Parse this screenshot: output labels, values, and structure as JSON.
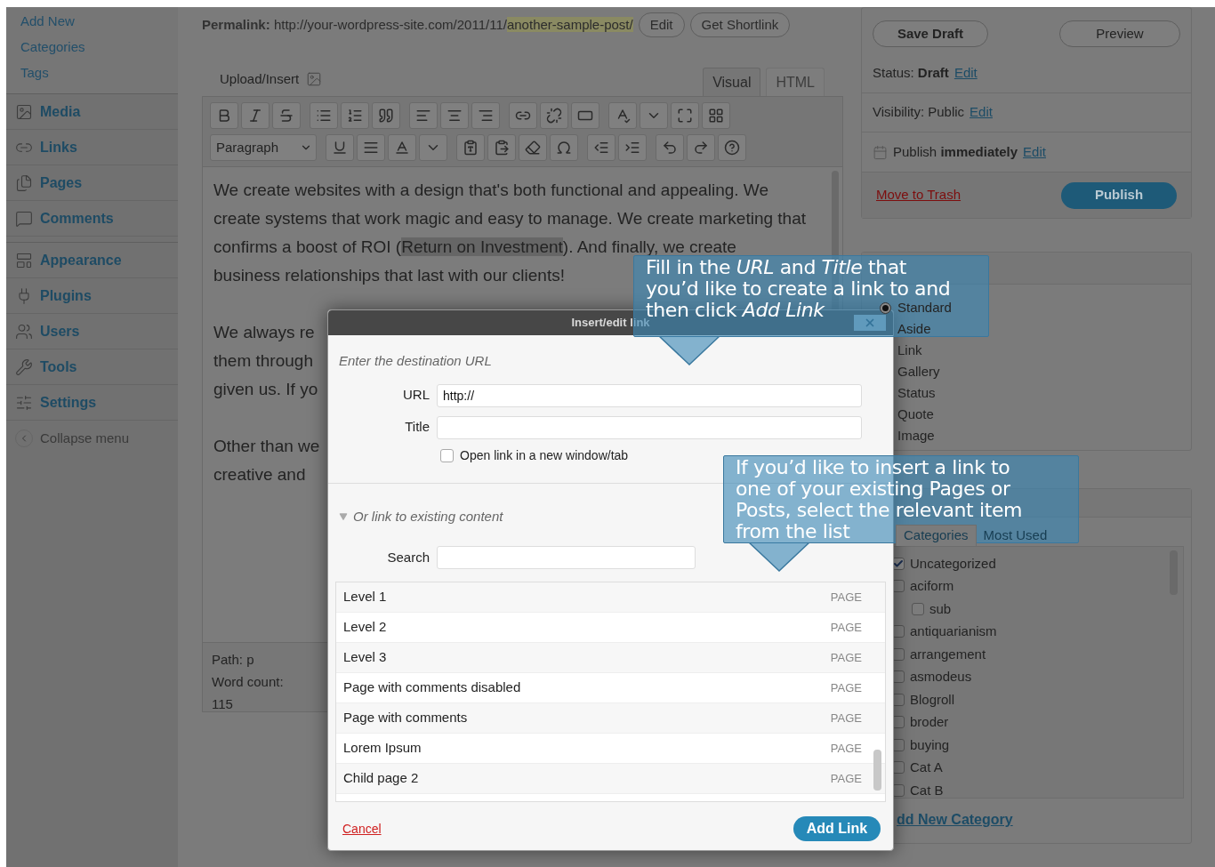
{
  "sidebar": {
    "submenu": [
      "Add New",
      "Categories",
      "Tags"
    ],
    "menu_groups": [
      {
        "items": [
          "Media",
          "Links",
          "Pages",
          "Comments"
        ]
      },
      {
        "items": [
          "Appearance",
          "Plugins",
          "Users",
          "Tools",
          "Settings"
        ]
      }
    ],
    "collapse": "Collapse menu"
  },
  "permalink": {
    "label": "Permalink:",
    "base": "http://your-wordpress-site.com/2011/11/",
    "slug": "another-sample-post/",
    "buttons": [
      "Edit",
      "Get Shortlink"
    ]
  },
  "upload_insert": "Upload/Insert",
  "editor_tabs": [
    {
      "label": "Visual",
      "selected": true
    },
    {
      "label": "HTML",
      "selected": false
    }
  ],
  "format_select": "Paragraph",
  "content": {
    "intro": {
      "before": "We create websites with a design that's both functional and appealing. We create systems that work magic and easy to manage. We create marketing that confirms a boost of ROI (",
      "selection": "Return on Investment",
      "after": "). And finally, we create business relationships that last with our clients!"
    },
    "partial_paragraphs": [
      [
        "We always re",
        "them through",
        "given us. If yo"
      ],
      [
        "Other than we",
        "creative and"
      ]
    ]
  },
  "path": {
    "label": "Path:",
    "value": "p"
  },
  "word_count": {
    "label": "Word count:",
    "value": "115"
  },
  "publish_box": {
    "buttons": [
      "Save Draft",
      "Preview"
    ],
    "rows": [
      {
        "kind": "plain",
        "text": "Status: **Draft**",
        "link": "Edit"
      },
      {
        "kind": "plain",
        "text": "Visibility: Public",
        "link": "Edit"
      },
      {
        "kind": "schedule",
        "text": "Publish **immediately**",
        "link": "Edit"
      }
    ],
    "trash": "Move to Trash",
    "publish": "Publish"
  },
  "format": {
    "options": [
      {
        "label": "Standard",
        "selected": true
      },
      {
        "label": "Aside"
      },
      {
        "label": "Link"
      },
      {
        "label": "Gallery"
      },
      {
        "label": "Status"
      },
      {
        "label": "Quote"
      },
      {
        "label": "Image"
      }
    ]
  },
  "categories": {
    "tabs": [
      {
        "label": "Categories",
        "selected": true
      },
      {
        "label": "Most Used",
        "selected": false
      }
    ],
    "items": [
      {
        "label": "Uncategorized",
        "checked": true
      },
      {
        "label": "aciform",
        "checked": false,
        "children": [
          {
            "label": "sub",
            "checked": false
          }
        ]
      },
      {
        "label": "antiquarianism",
        "checked": false
      },
      {
        "label": "arrangement",
        "checked": false
      },
      {
        "label": "asmodeus",
        "checked": false
      },
      {
        "label": "Blogroll",
        "checked": false
      },
      {
        "label": "broder",
        "checked": false
      },
      {
        "label": "buying",
        "checked": false
      },
      {
        "label": "Cat A",
        "checked": false
      },
      {
        "label": "Cat B",
        "checked": false
      }
    ],
    "add_new": "dd New Category"
  },
  "modal": {
    "title": "Insert/edit link",
    "intro": "Enter the destination URL",
    "url": {
      "label": "URL",
      "value": "http://"
    },
    "title_field": {
      "label": "Title"
    },
    "new_tab": {
      "label": "Open link in a new window/tab",
      "checked": false
    },
    "existing": {
      "label": "Or link to existing content",
      "expanded": true
    },
    "search": {
      "label": "Search"
    },
    "results": [
      {
        "title": "Level 1",
        "type": "PAGE"
      },
      {
        "title": "Level 2",
        "type": "PAGE"
      },
      {
        "title": "Level 3",
        "type": "PAGE"
      },
      {
        "title": "Page with comments disabled",
        "type": "PAGE"
      },
      {
        "title": "Page with comments",
        "type": "PAGE"
      },
      {
        "title": "Lorem Ipsum",
        "type": "PAGE"
      },
      {
        "title": "Child page 2",
        "type": "PAGE"
      }
    ],
    "cancel": "Cancel",
    "submit": "Add Link"
  },
  "callouts": [
    {
      "lines": [
        "Fill in the *URL* and *Title* that",
        "you’d like to create a link to and",
        "then click *Add Link*"
      ]
    },
    {
      "lines": [
        "If you’d like to insert a link to",
        "one of your existing Pages or",
        "Posts, select the relevant item",
        "from the list"
      ]
    }
  ]
}
